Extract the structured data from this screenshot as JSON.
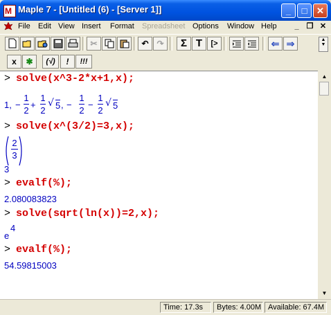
{
  "window": {
    "title": "Maple 7  - [Untitled (6) - [Server 1]]",
    "min_glyph": "_",
    "max_glyph": "□",
    "close_glyph": "✕"
  },
  "menu": {
    "items": [
      "File",
      "Edit",
      "View",
      "Insert",
      "Format",
      "Spreadsheet",
      "Options",
      "Window",
      "Help"
    ],
    "disabled": [
      "Spreadsheet"
    ],
    "mdi": [
      "_",
      "❐",
      "✕"
    ]
  },
  "toolbar": {
    "buttons": [
      "new-document",
      "open",
      "open-url",
      "save",
      "print",
      "cut",
      "copy",
      "paste",
      "undo",
      "redo",
      "sum",
      "text",
      "insert-prompt",
      "indent",
      "outdent",
      "back",
      "forward"
    ],
    "glyphs": {
      "sum": "Σ",
      "text": "T",
      "prompt": "[>",
      "back": "⇐",
      "forward": "⇒",
      "undo": "↶",
      "redo": "↷",
      "cut": "✂"
    }
  },
  "toolbar2": {
    "x_label": "x",
    "bug_glyph": "✱",
    "parens_label": "(√)",
    "bang_label": "!",
    "bangs_label": "!!!"
  },
  "worksheet": {
    "prompt": ">",
    "cmd1": "solve(x^3-2*x+1,x);",
    "cmd2": "solve(x^(3/2)=3,x);",
    "cmd3": "evalf(%);",
    "cmd4": "solve(sqrt(ln(x))=2,x);",
    "cmd5": "evalf(%);",
    "out1": {
      "one": "1,",
      "minus1": "−",
      "plus": "+",
      "comma": ",",
      "minus2": "−",
      "minus3": "−",
      "num": "1",
      "den": "2",
      "radicand": "5"
    },
    "out2": {
      "num": "2",
      "den": "3",
      "exponent": "3"
    },
    "out3": "2.080083823",
    "out4": {
      "base": "e",
      "exp": "4"
    },
    "out5": "54.59815003"
  },
  "status": {
    "time": "Time:  17.3s",
    "bytes": "Bytes: 4.00M",
    "available": "Available: 67.4M"
  }
}
